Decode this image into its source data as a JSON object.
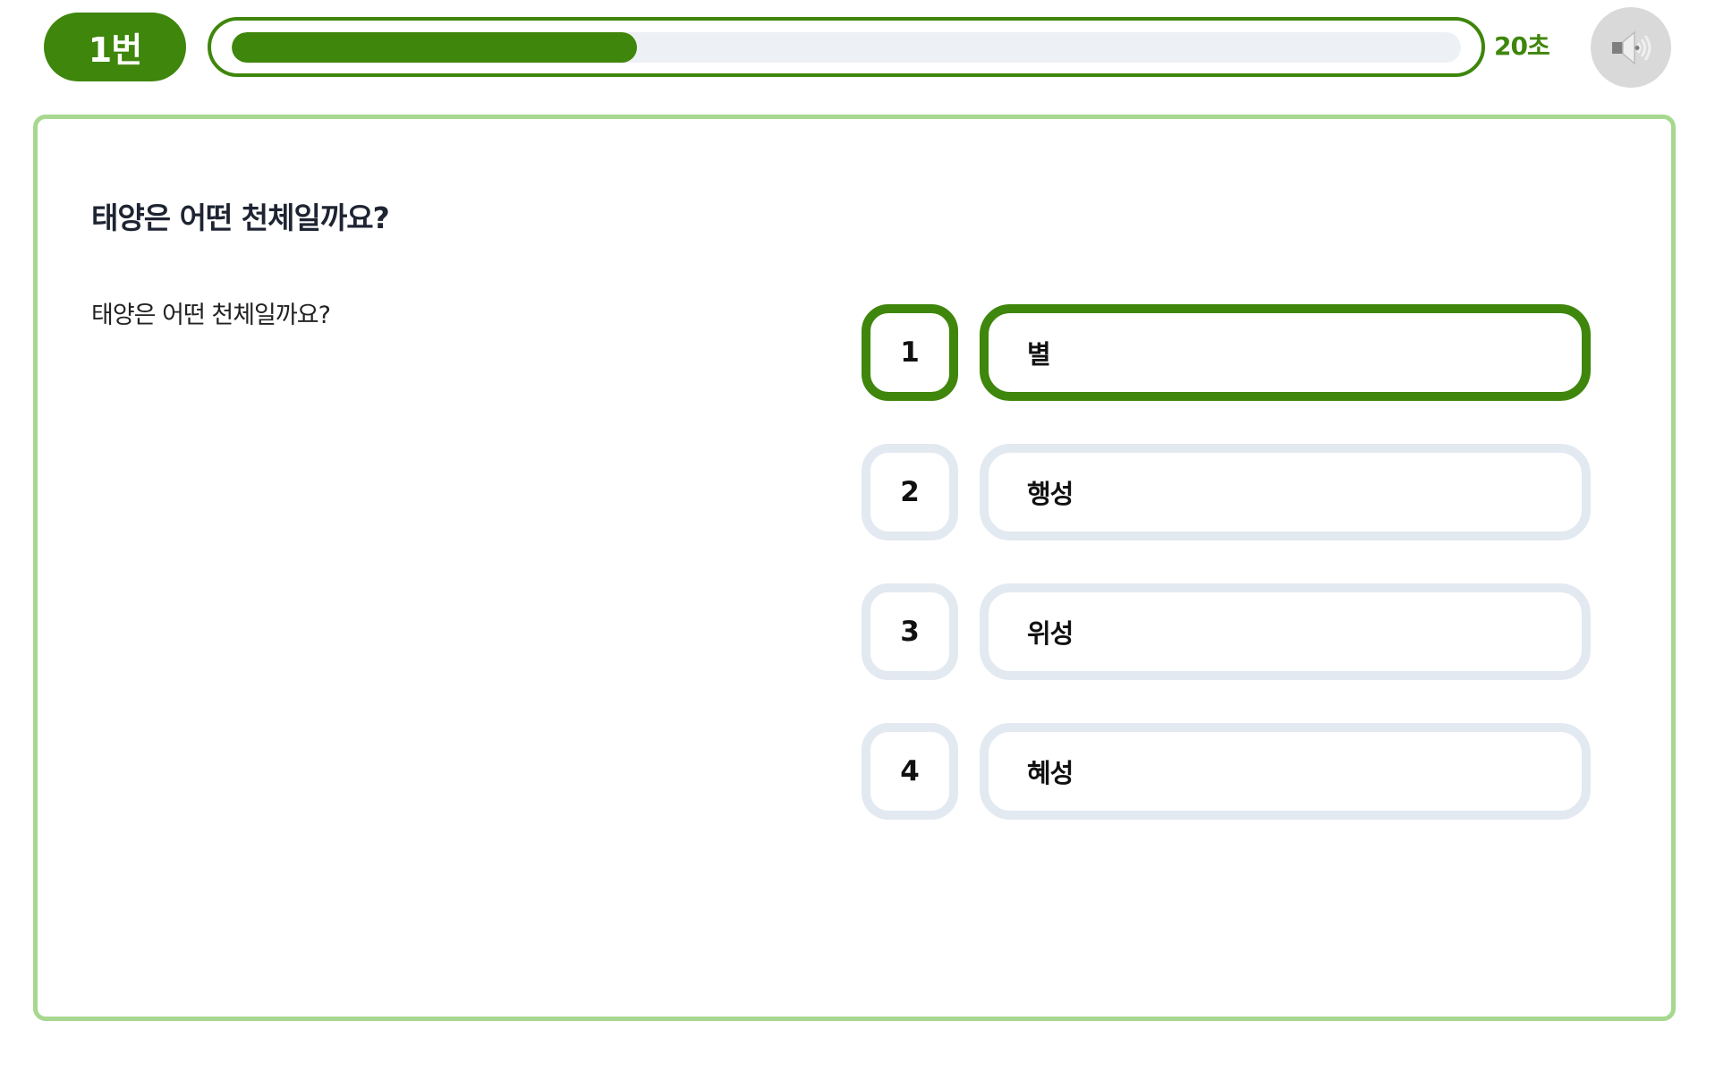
{
  "header": {
    "question_number_label": "1번",
    "timer_label": "20초",
    "timer_progress_fraction": 0.33,
    "sound_icon": "speaker-icon"
  },
  "question": {
    "title": "태양은 어떤 천체일까요?",
    "body": "태양은 어떤 천체일까요?"
  },
  "options": [
    {
      "number": "1",
      "label": "별",
      "selected": true
    },
    {
      "number": "2",
      "label": "행성",
      "selected": false
    },
    {
      "number": "3",
      "label": "위성",
      "selected": false
    },
    {
      "number": "4",
      "label": "혜성",
      "selected": false
    }
  ],
  "colors": {
    "accent": "#3f860c",
    "card_border": "#a7d88f",
    "option_border": "#e3e9f1",
    "timer_rail": "#edf1f5",
    "sound_button_bg": "#d9d9d9"
  }
}
